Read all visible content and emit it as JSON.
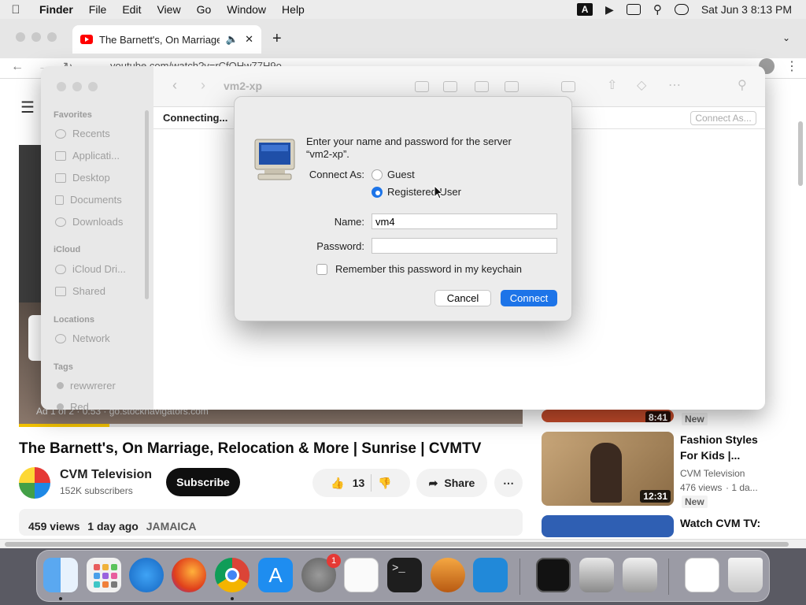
{
  "menubar": {
    "app": "Finder",
    "items": [
      "File",
      "Edit",
      "View",
      "Go",
      "Window",
      "Help"
    ],
    "input_badge": "A",
    "datetime": "Sat Jun 3  8:13 PM"
  },
  "browser": {
    "tab_title": "The Barnett's, On Marriage",
    "url": "youtube.com/watch?v=rCfQHw77H9o"
  },
  "video": {
    "title": "The Barnett's, On Marriage, Relocation & More | Sunrise | CVMTV",
    "ad_text": "Ad 1 of 2 · 0:53 · go.stocknavigators.com",
    "progress": 0.18,
    "channel": "CVM Television",
    "subscribers": "152K subscribers",
    "subscribe_label": "Subscribe",
    "likes": "13",
    "share_label": "Share",
    "views": "459 views",
    "age": "1 day ago",
    "tag": "JAMAICA"
  },
  "related": [
    {
      "duration": "8:41",
      "badge": "New"
    },
    {
      "title_line1": "Fashion Styles",
      "title_line2": "For Kids |...",
      "channel": "CVM Television",
      "views": "476 views",
      "age": "· 1 da...",
      "duration": "12:31",
      "badge": "New"
    },
    {
      "title_line1": "Watch CVM TV:"
    }
  ],
  "finder": {
    "title": "vm2-xp",
    "status": "Connecting...",
    "connect_as_label": "Connect As...",
    "sidebar": {
      "favorites_header": "Favorites",
      "favorites": [
        "Recents",
        "Applicati...",
        "Desktop",
        "Documents",
        "Downloads"
      ],
      "icloud_header": "iCloud",
      "icloud": [
        "iCloud Dri...",
        "Shared"
      ],
      "locations_header": "Locations",
      "locations": [
        "Network"
      ],
      "tags_header": "Tags",
      "tags": [
        "rewwrerer",
        "Red"
      ]
    }
  },
  "dialog": {
    "prompt_line1": "Enter your name and password for the server",
    "prompt_line2": "“vm2-xp”.",
    "connect_as_label": "Connect As:",
    "guest_label": "Guest",
    "registered_label": "Registered User",
    "selected": "Registered User",
    "name_label": "Name:",
    "name_value": "vm4",
    "password_label": "Password:",
    "password_value": "",
    "remember_label": "Remember this password in my keychain",
    "remember_checked": false,
    "cancel_label": "Cancel",
    "connect_label": "Connect"
  },
  "dock": {
    "settings_badge": "1"
  }
}
